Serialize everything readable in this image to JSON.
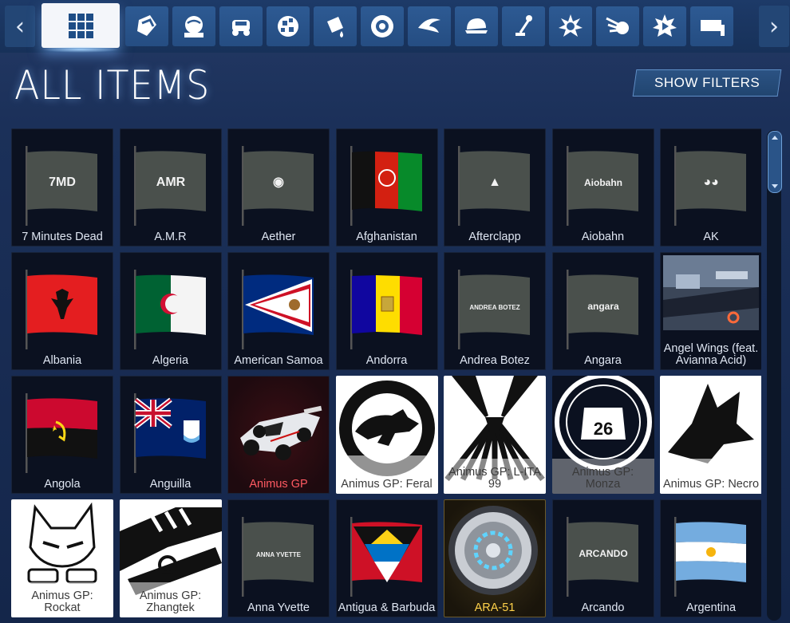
{
  "header": {
    "title": "ALL ITEMS",
    "filters_button": "SHOW FILTERS"
  },
  "tabs": [
    {
      "icon": "grid-icon",
      "active": true
    },
    {
      "icon": "decal-icon",
      "active": false
    },
    {
      "icon": "avatar-icon",
      "active": false
    },
    {
      "icon": "car-body-icon",
      "active": false
    },
    {
      "icon": "paint-finish-icon",
      "active": false
    },
    {
      "icon": "paint-bucket-icon",
      "active": false
    },
    {
      "icon": "wheel-icon",
      "active": false
    },
    {
      "icon": "rocket-boost-icon",
      "active": false
    },
    {
      "icon": "topper-cap-icon",
      "active": false
    },
    {
      "icon": "antenna-icon",
      "active": false
    },
    {
      "icon": "goal-explosion-icon",
      "active": false
    },
    {
      "icon": "trail-icon",
      "active": false
    },
    {
      "icon": "engine-audio-icon",
      "active": false
    },
    {
      "icon": "banner-icon",
      "active": false
    }
  ],
  "colors": {
    "accent": "#2d5a93",
    "rarity_red": "#ff5a62",
    "rarity_gold": "#ffd24a"
  },
  "items": [
    {
      "name": "7 Minutes Dead",
      "art": "flag-text",
      "label": "7MD"
    },
    {
      "name": "A.M.R",
      "art": "flag-text",
      "label": "AMR"
    },
    {
      "name": "Aether",
      "art": "flag-text",
      "label": "◉"
    },
    {
      "name": "Afghanistan",
      "art": "flag-afg"
    },
    {
      "name": "Afterclapp",
      "art": "flag-text",
      "label": "▲"
    },
    {
      "name": "Aiobahn",
      "art": "flag-text",
      "label": "Aiobahn"
    },
    {
      "name": "AK",
      "art": "flag-text",
      "label": "◕◕"
    },
    {
      "name": "Albania",
      "art": "flag-alb"
    },
    {
      "name": "Algeria",
      "art": "flag-alg"
    },
    {
      "name": "American Samoa",
      "art": "flag-asm"
    },
    {
      "name": "Andorra",
      "art": "flag-and"
    },
    {
      "name": "Andrea Botez",
      "art": "flag-text",
      "label": "ANDREA BOTEZ"
    },
    {
      "name": "Angara",
      "art": "flag-text",
      "label": "angara"
    },
    {
      "name": "Angel Wings (feat. Avianna Acid)",
      "art": "photo"
    },
    {
      "name": "Angola",
      "art": "flag-ago"
    },
    {
      "name": "Anguilla",
      "art": "flag-aia"
    },
    {
      "name": "Animus GP",
      "art": "car",
      "rarity": "red"
    },
    {
      "name": "Animus GP: Feral",
      "art": "decal-cat",
      "rarity": "white"
    },
    {
      "name": "Animus GP: L-ITA 99",
      "art": "decal-stripes",
      "rarity": "white"
    },
    {
      "name": "Animus GP: Monza",
      "art": "decal-26",
      "rarity": "white"
    },
    {
      "name": "Animus GP: Necro",
      "art": "decal-wolf",
      "rarity": "white"
    },
    {
      "name": "Animus GP: Rockat",
      "art": "decal-rockat",
      "rarity": "white"
    },
    {
      "name": "Animus GP: Zhangtek",
      "art": "decal-zhang",
      "rarity": "white"
    },
    {
      "name": "Anna Yvette",
      "art": "flag-text",
      "label": "ANNA YVETTE"
    },
    {
      "name": "Antigua & Barbuda",
      "art": "flag-atg"
    },
    {
      "name": "ARA-51",
      "art": "wheel",
      "rarity": "gold"
    },
    {
      "name": "Arcando",
      "art": "flag-text",
      "label": "ARCANDO"
    },
    {
      "name": "Argentina",
      "art": "flag-arg"
    }
  ]
}
